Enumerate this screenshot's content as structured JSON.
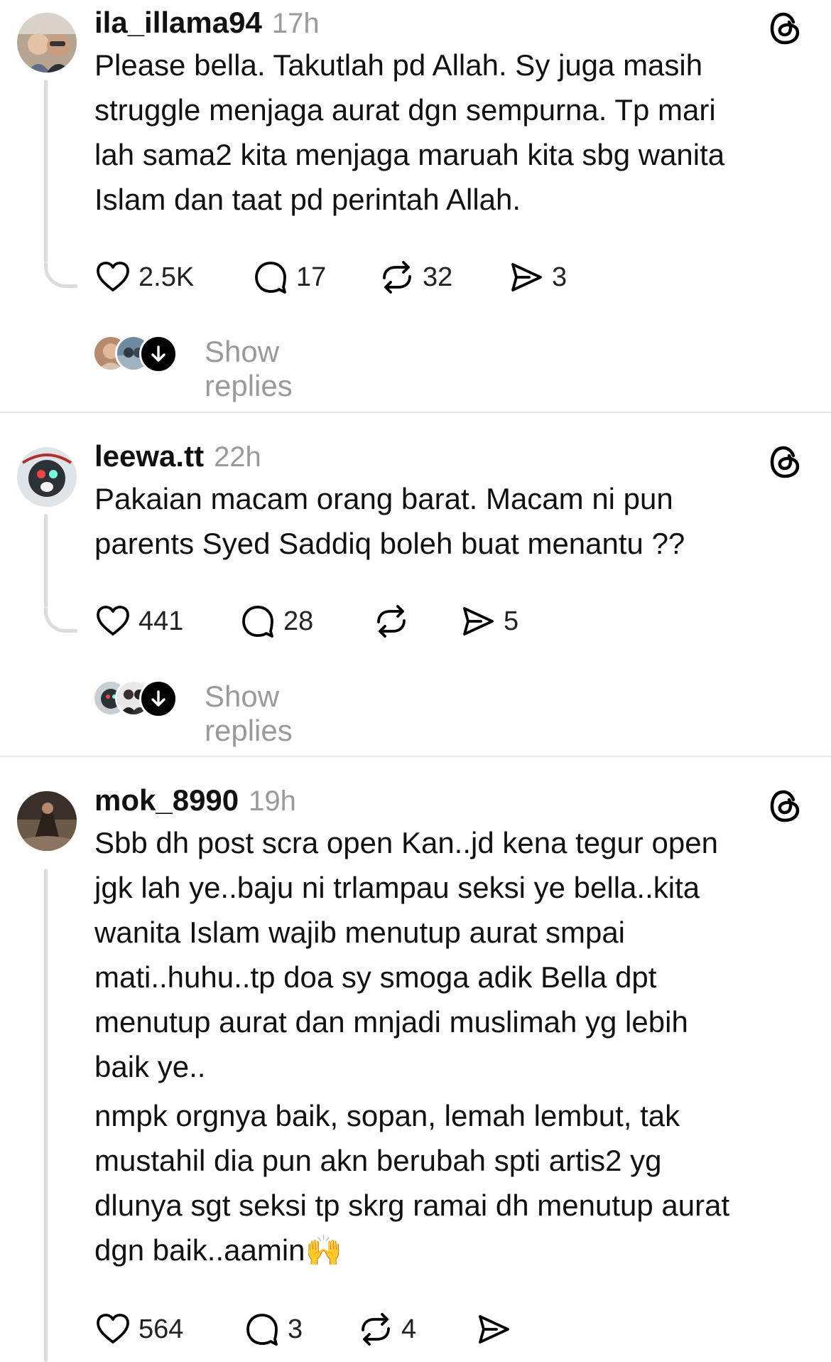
{
  "posts": [
    {
      "username": "ila_illama94",
      "time": "17h",
      "paragraphs": [
        [
          "Please bella. Takutlah pd Allah. Sy juga masih",
          "struggle menjaga aurat dgn sempurna. Tp mari",
          "lah sama2 kita menjaga maruah kita sbg wanita",
          "Islam dan taat pd perintah Allah."
        ]
      ],
      "likes": "2.5K",
      "comments": "17",
      "reposts": "32",
      "shares": "3",
      "show_replies": "Show replies"
    },
    {
      "username": "leewa.tt",
      "time": "22h",
      "paragraphs": [
        [
          "Pakaian macam orang barat. Macam ni pun",
          "parents Syed Saddiq boleh buat menantu ??"
        ]
      ],
      "likes": "441",
      "comments": "28",
      "reposts": "",
      "shares": "5",
      "show_replies": "Show replies"
    },
    {
      "username": "mok_8990",
      "time": "19h",
      "paragraphs": [
        [
          "Sbb dh post scra open Kan..jd kena tegur open",
          "jgk lah ye..baju ni trlampau seksi ye bella..kita",
          "wanita Islam wajib menutup aurat smpai",
          "mati..huhu..tp doa sy smoga adik Bella dpt",
          "menutup aurat dan mnjadi muslimah yg lebih",
          "baik ye.."
        ],
        [
          "nmpk orgnya baik, sopan, lemah lembut, tak",
          "mustahil dia pun akn berubah spti artis2 yg",
          "dlunya sgt seksi tp skrg ramai dh menutup aurat",
          "dgn baik..aamin🙌"
        ]
      ],
      "likes": "564",
      "comments": "3",
      "reposts": "4",
      "shares": ""
    }
  ],
  "icons": {
    "like": "heart-icon",
    "comment": "comment-bubble-icon",
    "repost": "repost-icon",
    "share": "send-icon",
    "logo": "threads-logo-icon",
    "expand": "arrow-down-icon"
  }
}
